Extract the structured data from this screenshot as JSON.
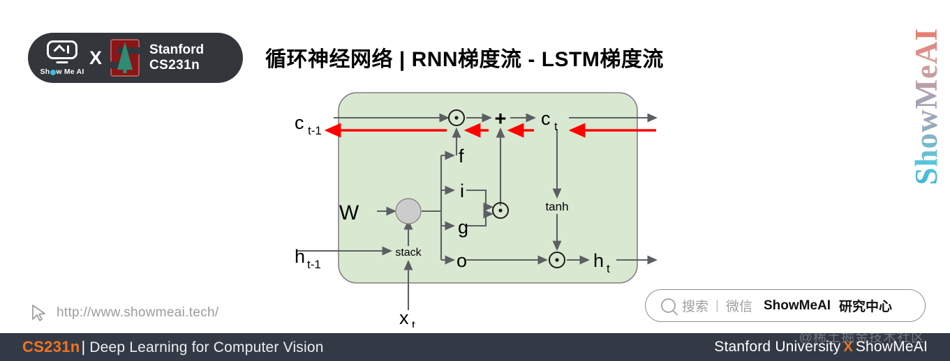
{
  "brand": {
    "logo_word": "Show Me AI",
    "logo_word_pre": "Sh",
    "logo_word_post": "w Me AI",
    "x_separator": "X",
    "stanford_line1": "Stanford",
    "stanford_line2": "CS231n"
  },
  "header": {
    "title": "循环神经网络 | RNN梯度流 - LSTM梯度流"
  },
  "vertical_wordmark": {
    "text": "ShowMeAI"
  },
  "diagram": {
    "type": "lstm-cell-gradient-flow",
    "box_fill": "#d9e8d0",
    "box_stroke": "#808080",
    "arrow_color": "#5b5f63",
    "gradient_arrow_color": "#ff0000",
    "node_fill": "#cccccc",
    "labels": {
      "c_prev_base": "c",
      "c_prev_sub": "t-1",
      "h_prev_base": "h",
      "h_prev_sub": "t-1",
      "x_t_base": "x",
      "x_t_sub": "t",
      "c_t_base": "c",
      "c_t_sub": "t",
      "h_t_base": "h",
      "h_t_sub": "t",
      "weight": "W",
      "stack": "stack",
      "gate_f": "f",
      "gate_i": "i",
      "gate_g": "g",
      "gate_o": "o",
      "tanh": "tanh",
      "plus": "+"
    }
  },
  "url_bar": {
    "url": "http://www.showmeai.tech/",
    "cursor_icon": "cursor-arrow-icon"
  },
  "search_pill": {
    "icon": "search-icon",
    "placeholder": "搜索",
    "divider": "|",
    "channel": "微信",
    "brand": "ShowMeAI",
    "suffix": "研究中心"
  },
  "footer": {
    "course_code": "CS231n",
    "pipe": "|",
    "course_title": "Deep Learning for Computer Vision",
    "university": "Stanford University",
    "x_separator": "X",
    "partner": "ShowMeAI",
    "watermark": "@稀土掘金技术社区",
    "bar_color": "#343a45",
    "accent_color": "#ef7522"
  }
}
